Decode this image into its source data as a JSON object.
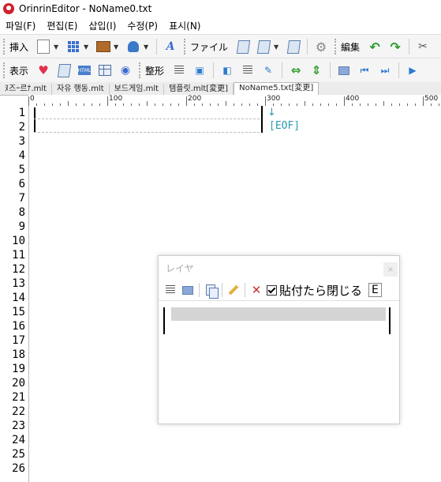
{
  "window": {
    "title": "OrinrinEditor - NoName0.txt"
  },
  "menu": [
    "파일(F)",
    "편집(E)",
    "삽입(I)",
    "수정(P)",
    "표시(N)"
  ],
  "toolbar1": {
    "insert_label": "挿入",
    "file_label": "ファイル",
    "edit_label": "編集"
  },
  "toolbar2": {
    "view_label": "表示",
    "format_label": "整形"
  },
  "tabs": [
    "ﾇ즈ｰ르ﾅ.mlt",
    "자유 행동.mlt",
    "보드게임.mlt",
    "템플릿.mlt[変更]",
    "NoName5.txt[変更]"
  ],
  "ruler": {
    "labels": [
      "0",
      "100",
      "200",
      "300",
      "400",
      "500"
    ]
  },
  "editor": {
    "line_numbers": [
      "1",
      "2",
      "3",
      "4",
      "5",
      "6",
      "7",
      "8",
      "9",
      "10",
      "11",
      "12",
      "13",
      "14",
      "15",
      "16",
      "17",
      "18",
      "19",
      "20",
      "21",
      "22",
      "23",
      "24",
      "25",
      "26"
    ],
    "eof_arrow": "↓",
    "eof_text": "[EOF]"
  },
  "layer_panel": {
    "title": "レイヤ",
    "close_symbol": "×",
    "checkbox_label": "貼付たら閉じる",
    "checkbox_checked": true,
    "truncated_button": "E"
  },
  "colors": {
    "eof": "#2a9ab0",
    "logo": "#d0202a",
    "accent": "#3a6ad0"
  }
}
